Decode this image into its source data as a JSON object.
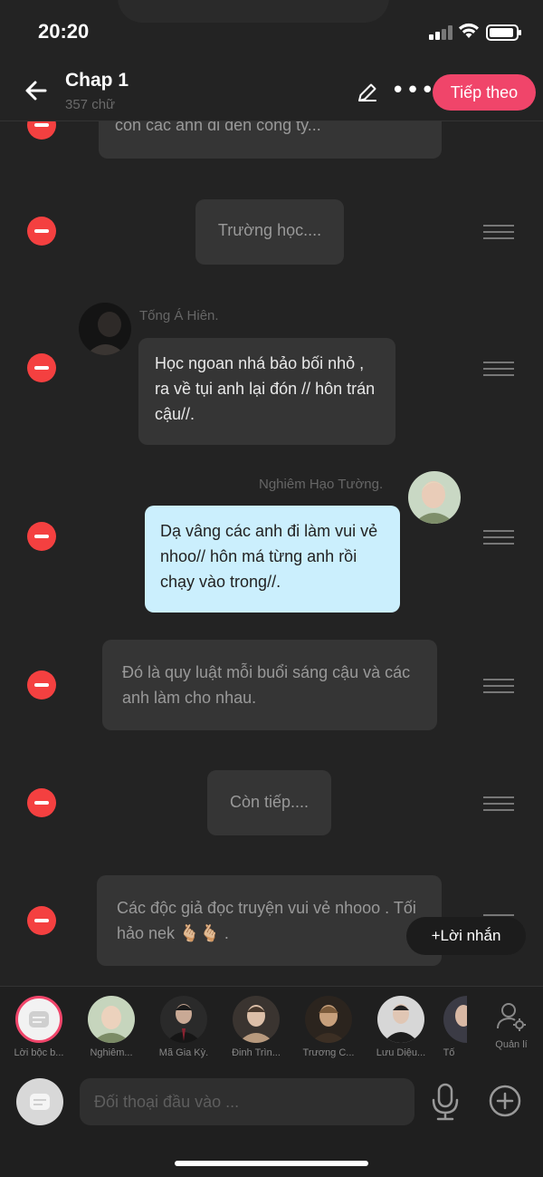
{
  "status_bar": {
    "time": "20:20"
  },
  "header": {
    "title": "Chap 1",
    "word_count": "357 chữ",
    "next_label": "Tiếp theo",
    "more_label": "•••"
  },
  "messages": [
    {
      "type": "narration",
      "text": "còn các anh đi đến công ty..."
    },
    {
      "type": "narration",
      "text": "Trường học...."
    },
    {
      "type": "character",
      "speaker": "Tống Á Hiên.",
      "text": "Học ngoan nhá bảo bối nhỏ , ra về tụi anh lại đón // hôn trán cậu//."
    },
    {
      "type": "me",
      "speaker": "Nghiêm Hạo Tường.",
      "text": "Dạ vâng các anh đi làm vui vẻ nhoo// hôn má từng anh rồi chạy vào trong//."
    },
    {
      "type": "narration",
      "text": "Đó là quy luật mỗi buổi sáng cậu và các anh làm cho nhau."
    },
    {
      "type": "narration",
      "text": "Còn tiếp...."
    },
    {
      "type": "narration",
      "text": "Các độc giả đọc truyện vui vẻ nhooo . Tối hảo nek 🫰🏼🫰🏼 ."
    }
  ],
  "float_button": {
    "label": "+Lời nhắn"
  },
  "characters": [
    {
      "name": "Lời bộc b..."
    },
    {
      "name": "Nghiêm..."
    },
    {
      "name": "Mã Gia Kỳ."
    },
    {
      "name": "Đinh Trìn..."
    },
    {
      "name": "Trương C..."
    },
    {
      "name": "Lưu Diệu..."
    },
    {
      "name": "Tố"
    }
  ],
  "manage_label": "Quản lí",
  "input": {
    "placeholder": "Đối thoại đầu vào ..."
  },
  "colors": {
    "accent": "#f0456a",
    "delete": "#f44040",
    "my_bubble": "#cbeffd"
  }
}
